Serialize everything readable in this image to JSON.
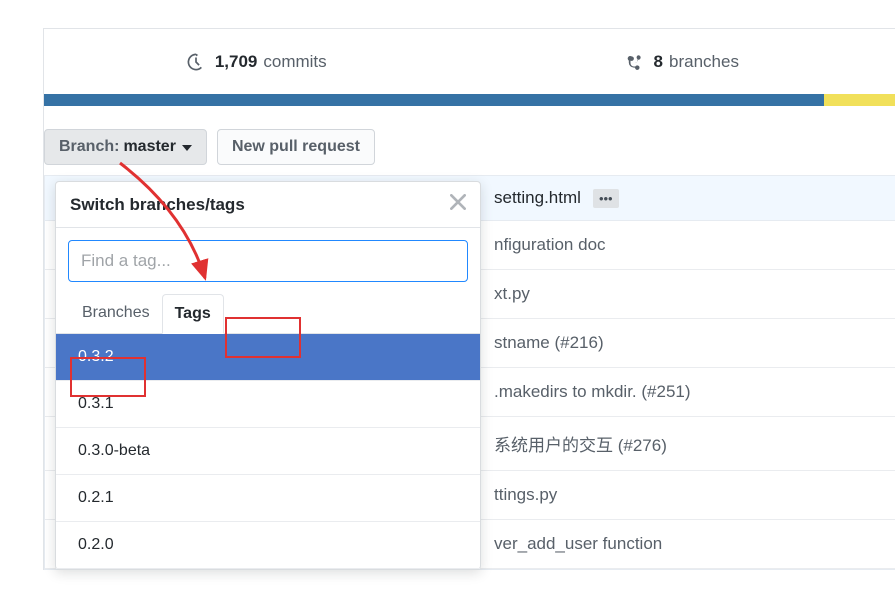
{
  "stats": {
    "commits_count": "1,709",
    "commits_label": "commits",
    "branches_count": "8",
    "branches_label": "branches"
  },
  "toolbar": {
    "branch_prefix": "Branch:",
    "branch_value": "master",
    "new_pr": "New pull request"
  },
  "commit_row": {
    "file": "setting.html",
    "ellipsis": "•••"
  },
  "file_rows": [
    "nfiguration doc",
    "xt.py",
    "stname (#216)",
    ".makedirs to mkdir. (#251)",
    "系统用户的交互 (#276)",
    "ttings.py",
    "ver_add_user function"
  ],
  "dropdown": {
    "title": "Switch branches/tags",
    "search_placeholder": "Find a tag...",
    "tab_branches": "Branches",
    "tab_tags": "Tags",
    "tags": [
      "0.3.2",
      "0.3.1",
      "0.3.0-beta",
      "0.2.1",
      "0.2.0"
    ],
    "selected_index": 0
  }
}
